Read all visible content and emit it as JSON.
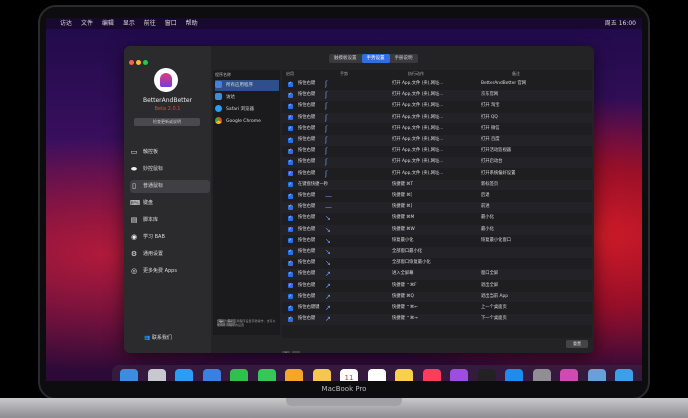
{
  "menubar": {
    "apple": "",
    "items": [
      "访达",
      "文件",
      "编辑",
      "显示",
      "前往",
      "窗口",
      "帮助"
    ],
    "clock": "周五 16:00"
  },
  "sidebar": {
    "app_name": "BetterAndBetter",
    "version": "Beta 2.0.1",
    "update_button": "检查更新或说明",
    "items": [
      {
        "label": "触控板",
        "icon": "trackpad-icon"
      },
      {
        "label": "妙控鼠标",
        "icon": "mouse-icon"
      },
      {
        "label": "普通鼠标",
        "icon": "mouse-regular-icon"
      },
      {
        "label": "键盘",
        "icon": "keyboard-icon"
      },
      {
        "label": "脚本库",
        "icon": "script-icon"
      },
      {
        "label": "学习 BAB",
        "icon": "learn-icon"
      },
      {
        "label": "通用设置",
        "icon": "settings-icon"
      },
      {
        "label": "更多免费 Apps",
        "icon": "apps-icon"
      }
    ],
    "contact": "联系我们"
  },
  "tabs": [
    "触摸板设置",
    "手势设置",
    "手册说明"
  ],
  "active_tab": 1,
  "programs": {
    "header": "程序名称",
    "items": [
      "所有应用程序",
      "访达",
      "Safari 浏览器",
      "Google Chrome"
    ],
    "add": "+",
    "remove": "-",
    "note": "*可以为每个应用程序设置手势操作，也可以使用所有程序的设置"
  },
  "table": {
    "headers": [
      "启用",
      "手势",
      "执行动作",
      "备注"
    ],
    "rows": [
      [
        "按住右键",
        "ʃ",
        "打开 App,文件 (夹),网址...",
        "BetterAndBetter 官网"
      ],
      [
        "按住右键",
        "ʃ",
        "打开 App,文件 (夹),网址...",
        "京东官网"
      ],
      [
        "按住右键",
        "ʃ",
        "打开 App,文件 (夹),网址...",
        "打开 淘宝"
      ],
      [
        "按住右键",
        "ʃ",
        "打开 App,文件 (夹),网址...",
        "打开 QQ"
      ],
      [
        "按住右键",
        "ʃ",
        "打开 App,文件 (夹),网址...",
        "打开 微信"
      ],
      [
        "按住右键",
        "ʃ",
        "打开 App,文件 (夹),网址...",
        "打开 百度"
      ],
      [
        "按住右键",
        "ʃ",
        "打开 App,文件 (夹),网址...",
        "打开活动监视器"
      ],
      [
        "按住右键",
        "ʃ",
        "打开 App,文件 (夹),网址...",
        "打开启动台"
      ],
      [
        "按住右键",
        "ʃ",
        "打开 App,文件 (夹),网址...",
        "打开系统偏好设置"
      ],
      [
        "在键盘快捷一秒",
        "",
        "快捷键 ⌘T",
        "新标签页"
      ],
      [
        "按住右键",
        "—",
        "快捷键 ⌘[",
        "后退"
      ],
      [
        "按住右键",
        "—",
        "快捷键 ⌘]",
        "前进"
      ],
      [
        "按住右键",
        "↘",
        "快捷键 ⌘M",
        "最小化"
      ],
      [
        "按住右键",
        "↘",
        "快捷键 ⌘W",
        "最小化"
      ],
      [
        "按住右键",
        "↘",
        "恢复最小化",
        "恢复最小化窗口"
      ],
      [
        "按住右键",
        "↘",
        "全部窗口最小化",
        ""
      ],
      [
        "按住右键",
        "↘",
        "全部窗口恢复最小化",
        ""
      ],
      [
        "按住右键",
        "↗",
        "进入全屏幕",
        "窗口全屏"
      ],
      [
        "按住右键",
        "↗",
        "快捷键 ⌃⌘F",
        "退出全屏"
      ],
      [
        "按住右键",
        "↗",
        "快捷键 ⌘Q",
        "退出当前 App"
      ],
      [
        "按住右键键",
        "↗",
        "快捷键 ⌃⌘←",
        "上一个桌面页"
      ],
      [
        "按住右键",
        "↗",
        "快捷键 ⌃⌘→",
        "下一个桌面页"
      ]
    ],
    "reset": "重置"
  },
  "dock_icons": [
    "finder-icon",
    "launchpad-icon",
    "safari-icon",
    "mail-icon",
    "facetime-icon",
    "messages-icon",
    "photos-icon",
    "notes-icon",
    "calendar-icon",
    "reminders-icon",
    "notes-app-icon",
    "music-icon",
    "podcasts-icon",
    "tv-icon",
    "appstore-icon",
    "system-prefs-icon",
    "bab-icon",
    "preview-icon",
    "folder-icon",
    "trash-icon"
  ],
  "calendar_day": "11",
  "laptop_label": "MacBook Pro"
}
